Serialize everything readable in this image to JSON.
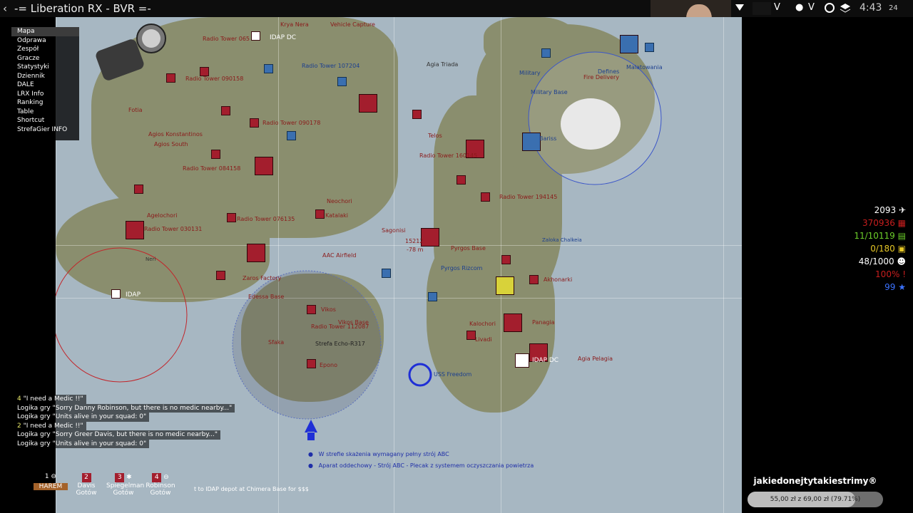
{
  "window": {
    "title": "-= Liberation RX - BVR =-",
    "back_icon": "chevron-left-icon"
  },
  "tray": {
    "v1": "V",
    "v2": "V",
    "time": "4:43",
    "seconds": "24"
  },
  "menu": {
    "items": [
      "Mapa",
      "Odprawa",
      "Zespół",
      "Gracze",
      "Statystyki",
      "Dziennik",
      "DALE",
      "LRX Info",
      "Ranking",
      "Table",
      "Shortcut",
      "StrefaGier INFO"
    ],
    "selected": "Mapa"
  },
  "stats": [
    {
      "value": "2093",
      "color": "#ffffff",
      "icon": "aircraft-icon"
    },
    {
      "value": "370936",
      "color": "#c81e1e",
      "icon": "ammo-icon"
    },
    {
      "value": "11/10119",
      "color": "#6ccf2a",
      "icon": "fuel-icon"
    },
    {
      "value": "0/180",
      "color": "#e7c826",
      "icon": "supply-icon"
    },
    {
      "value": "48/1000",
      "color": "#ffffff",
      "icon": "troops-icon"
    },
    {
      "value": "100%",
      "color": "#c81e1e",
      "icon": "alert-icon"
    },
    {
      "value": "99",
      "color": "#3b72ff",
      "icon": "star-icon"
    }
  ],
  "map_labels": [
    {
      "text": "IDAP DC",
      "color": "white"
    },
    {
      "text": "Vehicle Capture",
      "color": "red"
    },
    {
      "text": "Krya Nera",
      "color": "red"
    },
    {
      "text": "Radio Tower 065",
      "color": "red"
    },
    {
      "text": "Radio Tower 090158",
      "color": "red"
    },
    {
      "text": "Radio Tower 107204",
      "color": "blue"
    },
    {
      "text": "Radio Tower 090178",
      "color": "red"
    },
    {
      "text": "Radio Tower 084158",
      "color": "red"
    },
    {
      "text": "Radio Tower 076135",
      "color": "red"
    },
    {
      "text": "Radio Tower 160145",
      "color": "red"
    },
    {
      "text": "Radio Tower 194145",
      "color": "red"
    },
    {
      "text": "Radio Tower 030131",
      "color": "red"
    },
    {
      "text": "Radio Tower 112087",
      "color": "red"
    },
    {
      "text": "Agia Triada",
      "color": "dark"
    },
    {
      "text": "Agios Konstantinos",
      "color": "red"
    },
    {
      "text": "Agios South",
      "color": "red"
    },
    {
      "text": "Neochori",
      "color": "red"
    },
    {
      "text": "Telos",
      "color": "red"
    },
    {
      "text": "Sagonisi",
      "color": "red"
    },
    {
      "text": "Katalaki",
      "color": "red"
    },
    {
      "text": "Zaros Factory",
      "color": "red"
    },
    {
      "text": "Edessa Base",
      "color": "red"
    },
    {
      "text": "AAC Airfield",
      "color": "red"
    },
    {
      "text": "Vikos",
      "color": "red"
    },
    {
      "text": "Vikos Base",
      "color": "red"
    },
    {
      "text": "Sfaka",
      "color": "red"
    },
    {
      "text": "Epono",
      "color": "red"
    },
    {
      "text": "Strefa Echo-R317",
      "color": "dark"
    },
    {
      "text": "Pyrgos Base",
      "color": "red"
    },
    {
      "text": "Kalochori",
      "color": "red"
    },
    {
      "text": "Livadi",
      "color": "red"
    },
    {
      "text": "Panagia",
      "color": "red"
    },
    {
      "text": "Agia Pelagia",
      "color": "red"
    },
    {
      "text": "IDAP DC",
      "color": "white"
    },
    {
      "text": "IDAP",
      "color": "white"
    },
    {
      "text": "USS Freedom",
      "color": "blue"
    },
    {
      "text": "Military Base",
      "color": "blue"
    },
    {
      "text": "Zaloka Chalkeia",
      "color": "blue"
    },
    {
      "text": "Akhonarki",
      "color": "red"
    },
    {
      "text": "Fotia",
      "color": "red"
    },
    {
      "text": "Agelochori",
      "color": "red"
    },
    {
      "text": "Neri",
      "color": "dark"
    }
  ],
  "blue_units": [
    "Military",
    "Fire Delivery",
    "Defines",
    "Malatowania",
    "Bariss",
    "Pyrgos Rizcom"
  ],
  "chat": [
    {
      "sender": "4",
      "text": "\"I need a Medic !!\""
    },
    {
      "sender": "Logika gry",
      "text": "\"Sorry Danny Robinson, but there is no medic nearby...\""
    },
    {
      "sender": "Logika gry",
      "text": "\"Units alive in your squad: 0\""
    },
    {
      "sender": "2",
      "text": "\"I need a Medic !!\""
    },
    {
      "sender": "Logika gry",
      "text": "\"Sorry Greer Davis, but there is no medic nearby...\""
    },
    {
      "sender": "Logika gry",
      "text": "\"Units alive in your squad: 0\""
    }
  ],
  "squad": [
    {
      "num": "1",
      "name": "HAREM",
      "status": "",
      "icon": "minus-circle-icon"
    },
    {
      "num": "2",
      "name": "Davis",
      "status": "Gotów",
      "icon": ""
    },
    {
      "num": "3",
      "name": "Spiegelman",
      "status": "Gotów",
      "icon": "medic-icon"
    },
    {
      "num": "4",
      "name": "Robinson",
      "status": "Gotów",
      "icon": "minus-circle-icon"
    }
  ],
  "idap_message": "t to IDAP depot at Chimera Base for $$$",
  "notices": [
    "W strefie skażenia wymagany pełny strój ABC",
    "Aparat oddechowy - Strój ABC - Plecak z systemem oczyszczania powietrza"
  ],
  "donation": {
    "channel": "jakiedonejtytakiestrimy®",
    "bar_text": "55,00 zł z 69,00 zł (79.71%)",
    "progress": 0.7971
  },
  "map_readout": {
    "coords": "15212",
    "alt": "-78 m"
  }
}
